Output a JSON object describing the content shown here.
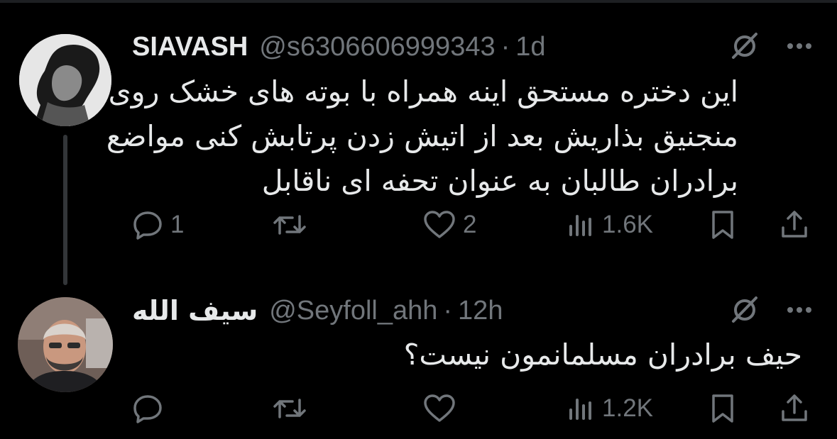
{
  "colors": {
    "background": "#000000",
    "text": "#e7e9ea",
    "muted": "#71767b",
    "thread_line": "#333639"
  },
  "tweets": [
    {
      "name": "SIAVASH",
      "handle": "@s6306606999343",
      "separator": "·",
      "time": "1d",
      "text_lines": [
        "این دختره مستحق اینه همراه با بوته های خشک روی",
        "منجنیق بذاریش بعد از اتیش زدن پرتابش کنی مواضع",
        "برادران طالبان به عنوان تحفه ای ناقابل"
      ],
      "replies": "1",
      "retweets": "",
      "likes": "2",
      "views": "1.6K",
      "avatar_icon": "profile-photo"
    },
    {
      "name": "سیف الله",
      "handle": "@Seyfoll_ahh",
      "separator": "·",
      "time": "12h",
      "text": "حیف برادران مسلمانمون نیست؟",
      "replies": "",
      "retweets": "",
      "likes": "",
      "views": "1.2K",
      "avatar_icon": "profile-photo"
    }
  ],
  "icons": {
    "grok": "grok-icon",
    "more": "more-icon",
    "reply": "reply-icon",
    "retweet": "retweet-icon",
    "like": "heart-icon",
    "views": "views-icon",
    "bookmark": "bookmark-icon",
    "share": "share-icon"
  }
}
